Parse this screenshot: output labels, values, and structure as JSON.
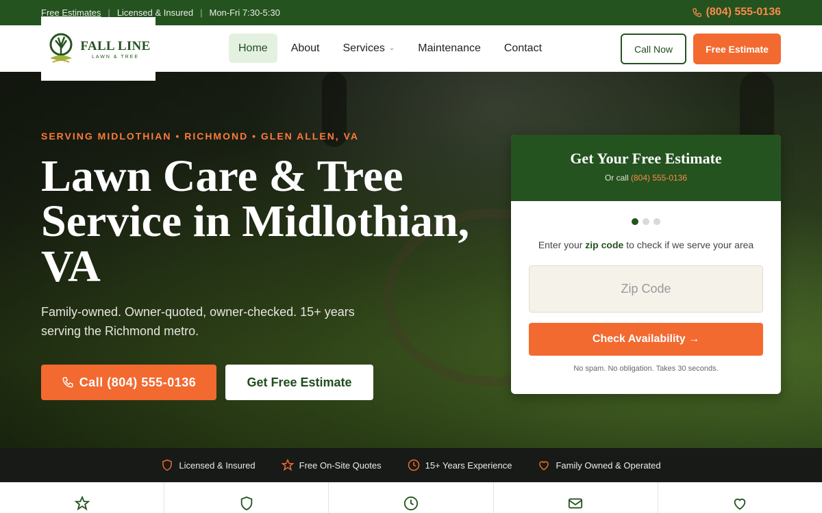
{
  "topbar": {
    "items": [
      "Free Estimates",
      "Licensed & Insured",
      "Mon-Fri 7:30-5:30"
    ],
    "phone": "(804) 555-0136"
  },
  "logo": {
    "line1": "FALL LINE",
    "line2": "LAWN & TREE"
  },
  "nav": {
    "items": [
      "Home",
      "About",
      "Services",
      "Maintenance",
      "Contact"
    ],
    "active": "Home",
    "call_label": "Call Now",
    "estimate_label": "Free Estimate"
  },
  "hero": {
    "tagline": "SERVING MIDLOTHIAN • RICHMOND • GLEN ALLEN, VA",
    "headline": "Lawn Care & Tree Service in Midlothian, VA",
    "subtext": "Family-owned. Owner-quoted, owner-checked. 15+ years serving the Richmond metro.",
    "call_button": "Call (804) 555-0136",
    "estimate_button": "Get Free Estimate"
  },
  "estimate_card": {
    "title": "Get Your Free Estimate",
    "or_call": "Or call",
    "phone": "(804) 555-0136",
    "step": 1,
    "total_steps": 3,
    "prompt_pre": "Enter your",
    "prompt_highlight": "zip code",
    "prompt_post": "to check if we serve your area",
    "zip_placeholder": "Zip Code",
    "button": "Check Availability →",
    "note": "No spam. No obligation. Takes 30 seconds."
  },
  "trust": {
    "items": [
      {
        "icon": "shield-icon",
        "label": "Licensed & Insured"
      },
      {
        "icon": "star-icon",
        "label": "Free On-Site Quotes"
      },
      {
        "icon": "clock-icon",
        "label": "15+ Years Experience"
      },
      {
        "icon": "heart-icon",
        "label": "Family Owned & Operated"
      }
    ]
  },
  "bottom_icons": [
    "star-icon",
    "shield-icon",
    "clock-icon",
    "mail-icon",
    "heart-icon"
  ],
  "colors": {
    "brand_green": "#24531f",
    "accent_orange": "#f26a30",
    "dark_strip": "#171a16"
  }
}
